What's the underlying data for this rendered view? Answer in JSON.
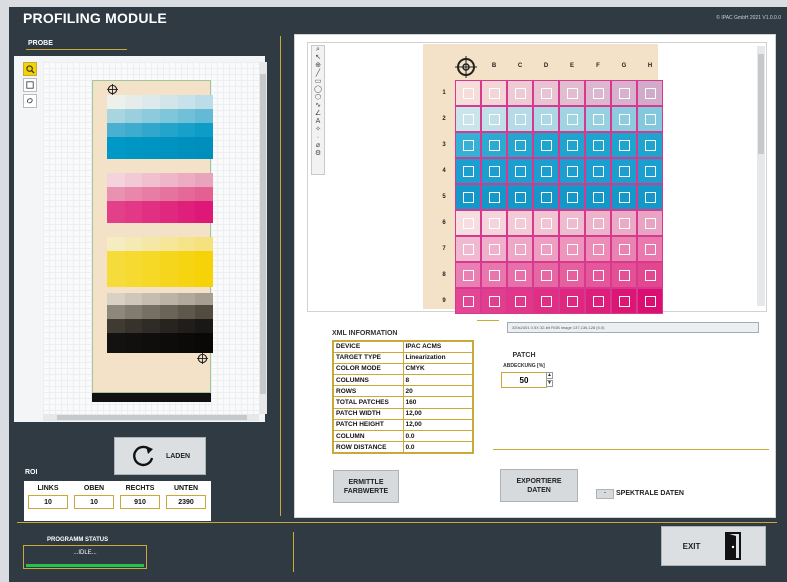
{
  "app": {
    "title": "PROFILING MODULE",
    "copyright": "© IPAC GmbH 2021 V1.0.0.0"
  },
  "probe": {
    "label": "PROBE",
    "tools": [
      "zoom-icon",
      "rect-select-icon",
      "lasso-icon"
    ]
  },
  "laden": {
    "label": "LADEN"
  },
  "roi": {
    "label": "ROI",
    "fields": [
      {
        "label": "LINKS",
        "value": "10"
      },
      {
        "label": "OBEN",
        "value": "10"
      },
      {
        "label": "RECHTS",
        "value": "910"
      },
      {
        "label": "UNTEN",
        "value": "2390"
      }
    ]
  },
  "status": {
    "label": "PROGRAMM STATUS",
    "text": "...IDLE..."
  },
  "exit": {
    "label": "EXIT"
  },
  "viewer": {
    "columns": [
      "B",
      "C",
      "D",
      "E",
      "F",
      "G",
      "H"
    ],
    "rows": [
      "1",
      "2",
      "3",
      "4",
      "5",
      "6",
      "7",
      "8",
      "9"
    ],
    "info": "320x2401 0.5X 32-bit RGB image 137,136,128   (0,0)"
  },
  "xml": {
    "title": "XML INFORMATION",
    "rows": [
      {
        "key": "DEVICE",
        "value": "IPAC ACMS"
      },
      {
        "key": "TARGET TYPE",
        "value": "Linearization"
      },
      {
        "key": "COLOR MODE",
        "value": "CMYK"
      },
      {
        "key": "COLUMNS",
        "value": "8"
      },
      {
        "key": "ROWS",
        "value": "20"
      },
      {
        "key": "TOTAL PATCHES",
        "value": "160"
      },
      {
        "key": "PATCH WIDTH",
        "value": "12,00"
      },
      {
        "key": "PATCH HEIGHT",
        "value": "12,00"
      },
      {
        "key": "COLUMN",
        "value": "0.0"
      },
      {
        "key": "ROW DISTANCE",
        "value": "0.0"
      }
    ]
  },
  "patch": {
    "label": "PATCH",
    "sublabel": "ABDECKUNG [%]",
    "value": "50"
  },
  "buttons": {
    "ermittle": "ERMITTLE\nFARBWERTE",
    "exportiere": "EXPORTIERE\nDATEN",
    "spektrale": "SPEKTRALE DATEN"
  },
  "colors": {
    "panel": "#2f3a42",
    "gold": "#c8a93a",
    "magenta": "#d63a8f",
    "cyan": "#1ea5cf"
  }
}
